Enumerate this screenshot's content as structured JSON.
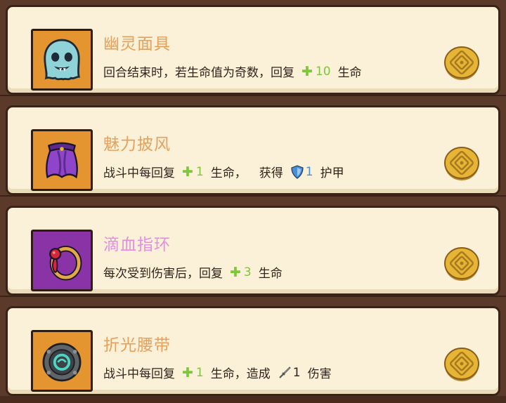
{
  "relics": [
    {
      "name": "幽灵面具",
      "title_color": "#e7a05a",
      "bg": "#e4952f",
      "icon": "ghost-mask-icon",
      "desc_before": "回合结束时，若生命值为奇数，回复",
      "stat_value": "10",
      "stat_unit": "生命",
      "desc_extra": "",
      "extra_value": "",
      "extra_unit": ""
    },
    {
      "name": "魅力披风",
      "title_color": "#e7a05a",
      "bg": "#e4952f",
      "icon": "cloak-icon",
      "desc_before": "战斗中每回复",
      "stat_value": "1",
      "stat_unit": "生命，",
      "desc_extra": "获得",
      "extra_value": "1",
      "extra_unit": "护甲"
    },
    {
      "name": "滴血指环",
      "title_color": "#e58fe0",
      "bg": "#8a33a6",
      "icon": "blood-ring-icon",
      "desc_before": "每次受到伤害后，回复",
      "stat_value": "3",
      "stat_unit": "生命",
      "desc_extra": "",
      "extra_value": "",
      "extra_unit": ""
    },
    {
      "name": "折光腰带",
      "title_color": "#e7a05a",
      "bg": "#e4952f",
      "icon": "belt-icon",
      "desc_before": "战斗中每回复",
      "stat_value": "1",
      "stat_unit": "生命，造成",
      "desc_extra": "",
      "extra_value": "1",
      "extra_unit": "伤害"
    }
  ],
  "icons": {
    "plus": "plus-icon",
    "shield": "shield-icon",
    "sword": "sword-icon",
    "coin": "gold-coin-icon"
  },
  "colors": {
    "heal_green": "#7cc83a",
    "armor_blue": "#4a8fd6",
    "coin_gold": "#e6b536"
  }
}
